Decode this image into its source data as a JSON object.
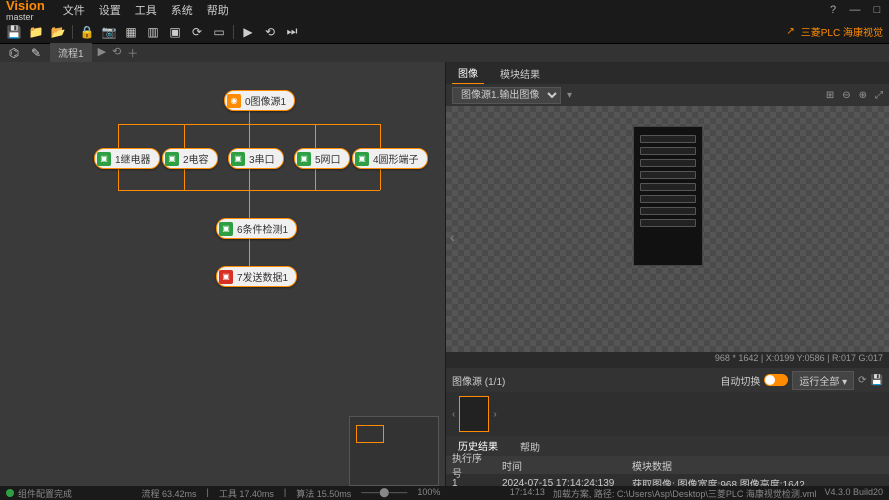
{
  "app": {
    "name": "Vision",
    "sub": "master"
  },
  "menu": {
    "file": "文件",
    "config": "设置",
    "tool": "工具",
    "system": "系统",
    "help": "帮助"
  },
  "toolbar_right": {
    "label": "三菱PLC 海康视觉"
  },
  "flow_tab": {
    "name": "流程1"
  },
  "nodes": {
    "n0": "0图像源1",
    "n1": "1继电器",
    "n2": "2电容",
    "n3": "3串口",
    "n4": "5网口",
    "n5": "4圆形端子",
    "n6": "6条件检测1",
    "n7": "7发送数据1"
  },
  "side": {
    "tab_image": "图像",
    "tab_module": "模块结果",
    "img_selector": "图像源1.输出图像",
    "img_info": "968 * 1642  | X:0199 Y:0586 | R:017 G:017",
    "src_label": "图像源 (1/1)",
    "auto_label": "自动切换",
    "run_all": "运行全部",
    "hist_tab": "历史结果",
    "help_tab": "帮助"
  },
  "table": {
    "h1": "执行序号",
    "h2": "时间",
    "h3": "模块数据",
    "r1_seq": "1",
    "r1_time": "2024-07-15 17:14:24:139",
    "r1_data": "获取图像: 图像宽度:968 图像高度:1642"
  },
  "status": {
    "msg": "组件配置完成",
    "flow": "流程 63.42ms",
    "tool": "工具 17.40ms",
    "algo": "算法 15.50ms",
    "zoom": "100%",
    "time": "17:14:13",
    "load": "加载方案, 路径: C:\\Users\\Asp\\Desktop\\三菱PLC 海康视觉检测.vml",
    "ver": "V4.3.0 Build20"
  }
}
